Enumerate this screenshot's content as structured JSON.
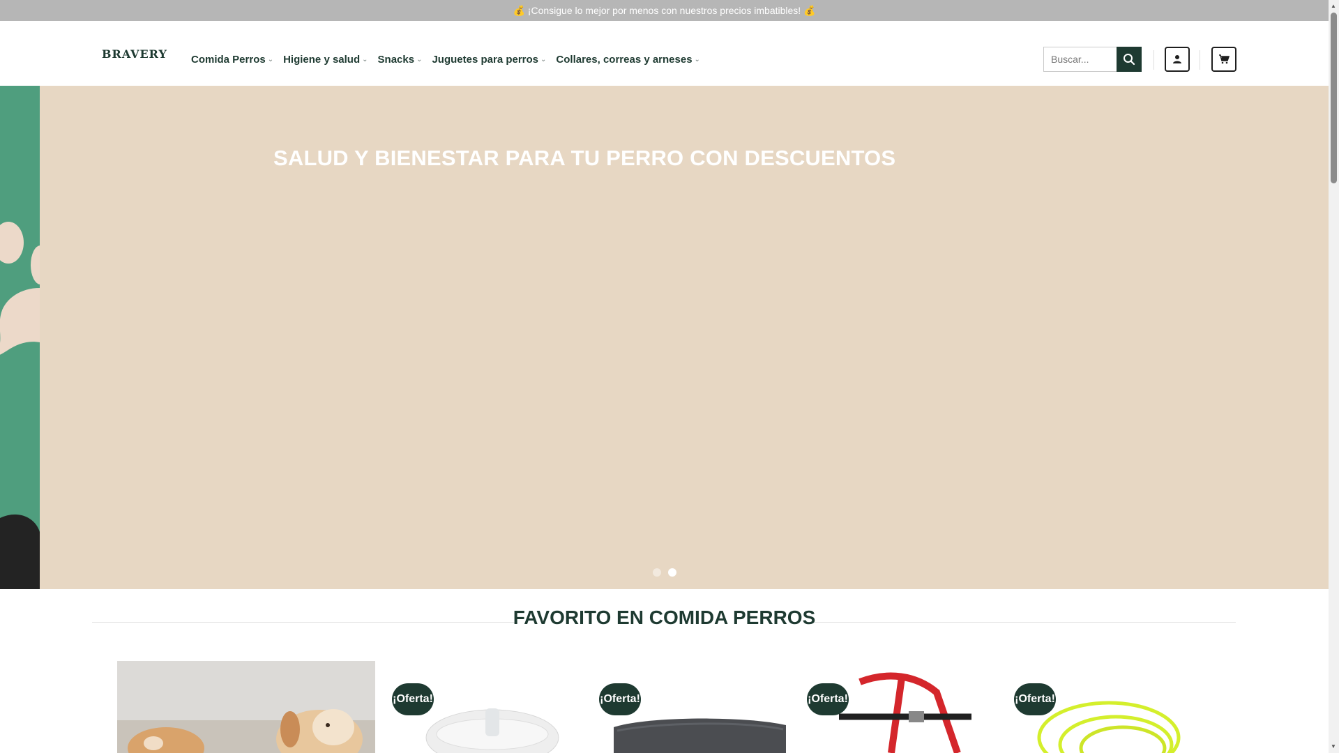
{
  "topbar": {
    "text": "💰 ¡Consigue lo mejor por menos con nuestros precios imbatibles! 💰"
  },
  "header": {
    "logo": "BRAVERY",
    "nav": [
      {
        "label": "Comida Perros"
      },
      {
        "label": "Higiene y salud"
      },
      {
        "label": "Snacks"
      },
      {
        "label": "Juguetes para perros"
      },
      {
        "label": "Collares, correas y arneses"
      }
    ],
    "search": {
      "placeholder": "Buscar..."
    }
  },
  "hero": {
    "title": "SALUD Y BIENESTAR PARA TU PERRO CON DESCUENTOS",
    "slide_count": 2,
    "active_slide": 2
  },
  "section": {
    "title": "FAVORITO EN COMIDA PERROS"
  },
  "products": [
    {
      "badge": "¡Oferta!"
    },
    {
      "badge": "¡Oferta!"
    },
    {
      "badge": "¡Oferta!"
    },
    {
      "badge": "¡Oferta!"
    }
  ],
  "colors": {
    "brand": "#1e3a31",
    "hero_bg": "#e7d7c3",
    "green_strip": "#4f9e7e",
    "topbar": "#b6b6b6"
  },
  "icons": [
    "chevron-down-icon",
    "search-icon",
    "user-icon",
    "cart-icon",
    "paw-icon"
  ]
}
